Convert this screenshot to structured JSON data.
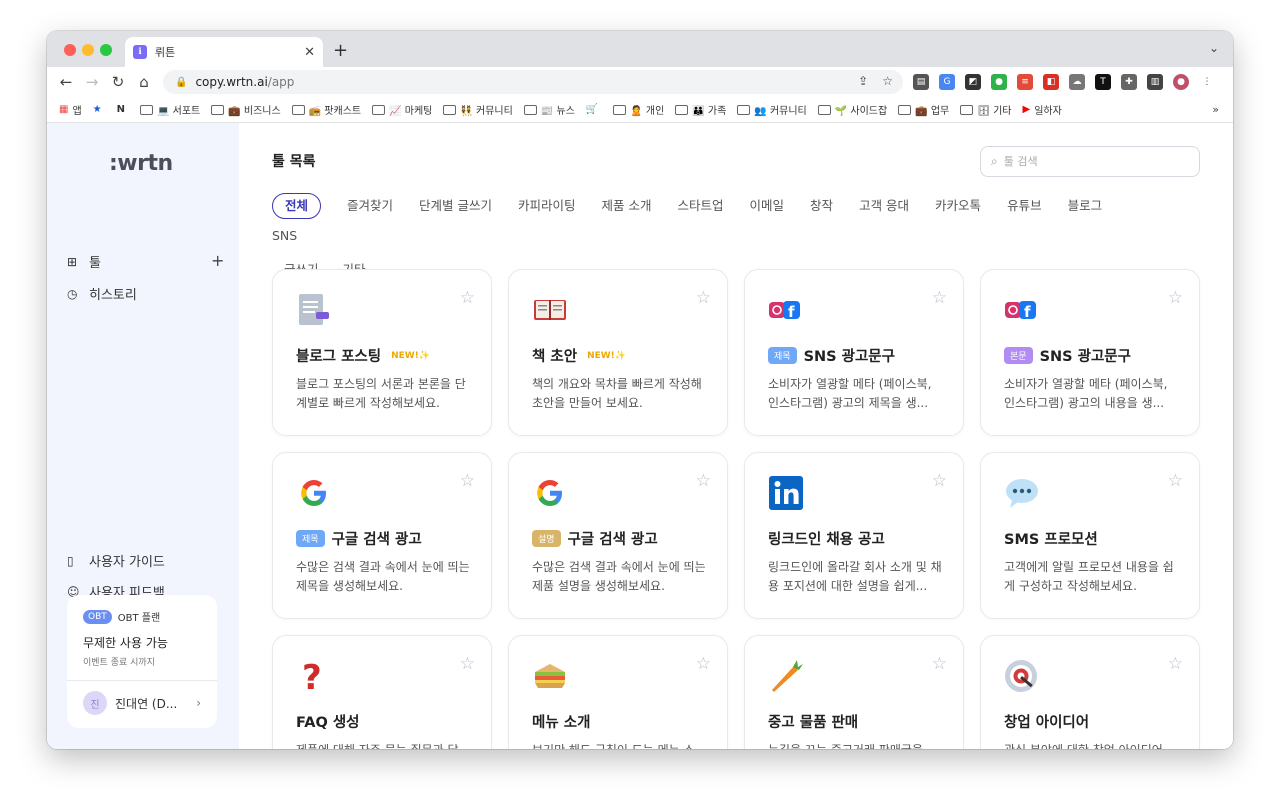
{
  "browser": {
    "tab_title": "뤼튼",
    "tab_favicon": "ℹ",
    "url_host": "copy.wrtn.ai",
    "url_path": "/app",
    "bookmarks": [
      {
        "icon": "apps-icon",
        "label": "앱"
      },
      {
        "icon": "star-icon",
        "label": ""
      },
      {
        "icon": "notion-icon",
        "label": ""
      },
      {
        "icon": "folder-icon",
        "label": "💻 서포트"
      },
      {
        "icon": "folder-icon",
        "label": "💼 비즈니스"
      },
      {
        "icon": "folder-icon",
        "label": "📻 팟캐스트"
      },
      {
        "icon": "folder-icon",
        "label": "📈 마케팅"
      },
      {
        "icon": "folder-icon",
        "label": "👯 커뮤니티"
      },
      {
        "icon": "folder-icon",
        "label": "📰 뉴스"
      },
      {
        "icon": "cart-icon",
        "label": ""
      },
      {
        "icon": "folder-icon",
        "label": "🙎 개인"
      },
      {
        "icon": "folder-icon",
        "label": "👪 가족"
      },
      {
        "icon": "folder-icon",
        "label": "👥 커뮤니티"
      },
      {
        "icon": "folder-icon",
        "label": "🌱 사이드잡"
      },
      {
        "icon": "folder-icon",
        "label": "💼 업무"
      },
      {
        "icon": "folder-icon",
        "label": "🗄 기타"
      },
      {
        "icon": "youtube-icon",
        "label": "일하자"
      }
    ]
  },
  "sidebar": {
    "logo": ":wrtn",
    "tools_label": "툴",
    "history_label": "히스토리",
    "guide_label": "사용자 가이드",
    "feedback_label": "사용자 피드백",
    "obt": {
      "badge": "OBT",
      "plan": "OBT 플랜",
      "title": "무제한 사용 가능",
      "subtitle": "이벤트 종료 시까지"
    },
    "user": {
      "avatar": "진",
      "name": "진대연 (D..."
    }
  },
  "main": {
    "title": "툴 목록",
    "search_placeholder": "툴 검색",
    "categories_row1": [
      "전체",
      "즐겨찾기",
      "단계별 글쓰기",
      "카피라이팅",
      "제품 소개",
      "스타트업",
      "이메일",
      "창작",
      "고객 응대",
      "카카오톡",
      "유튜브",
      "블로그",
      "SNS"
    ],
    "categories_row2": [
      "글쓰기",
      "기타"
    ],
    "cards": [
      {
        "icon": "document-icon",
        "title": "블로그 포스팅",
        "tag": "",
        "new": "NEW!✨",
        "desc": "블로그 포스팅의 서론과 본론을 단계별로 빠르게 작성해보세요."
      },
      {
        "icon": "book-icon",
        "title": "책 초안",
        "tag": "",
        "new": "NEW!✨",
        "desc": "책의 개요와 목차를 빠르게 작성해 초안을 만들어 보세요."
      },
      {
        "icon": "instagram-facebook-icon",
        "title": "SNS 광고문구",
        "tag": "제목",
        "new": "",
        "desc": "소비자가 열광할 메타 (페이스북, 인스타그램) 광고의 제목을 생..."
      },
      {
        "icon": "instagram-facebook-icon",
        "title": "SNS 광고문구",
        "tag": "본문",
        "new": "",
        "desc": "소비자가 열광할 메타 (페이스북, 인스타그램) 광고의 내용을 생..."
      },
      {
        "icon": "google-icon",
        "title": "구글 검색 광고",
        "tag": "제목",
        "new": "",
        "desc": "수많은 검색 결과 속에서 눈에 띄는 제목을 생성해보세요."
      },
      {
        "icon": "google-icon",
        "title": "구글 검색 광고",
        "tag": "설명",
        "new": "",
        "desc": "수많은 검색 결과 속에서 눈에 띄는 제품 설명을 생성해보세요."
      },
      {
        "icon": "linkedin-icon",
        "title": "링크드인 채용 공고",
        "tag": "",
        "new": "",
        "desc": "링크드인에 올라갈 회사 소개 및 채용 포지션에 대한 설명을 쉽게..."
      },
      {
        "icon": "speech-bubble-icon",
        "title": "SMS 프로모션",
        "tag": "",
        "new": "",
        "desc": "고객에게 알릴 프로모션 내용을 쉽게 구성하고 작성해보세요."
      },
      {
        "icon": "question-mark-icon",
        "title": "FAQ 생성",
        "tag": "",
        "new": "",
        "desc": "제품에 대해 자주 묻는 질문과 답..."
      },
      {
        "icon": "sandwich-icon",
        "title": "메뉴 소개",
        "tag": "",
        "new": "",
        "desc": "보기만 해도 군침이 도는 메뉴 소..."
      },
      {
        "icon": "carrot-icon",
        "title": "중고 물품 판매",
        "tag": "",
        "new": "",
        "desc": "눈길을 끄는 중고거래 판매글을..."
      },
      {
        "icon": "dart-target-icon",
        "title": "창업 아이디어",
        "tag": "",
        "new": "",
        "desc": "관심 분야에 대한 창업 아이디어..."
      }
    ],
    "tag_colors": {
      "제목": "#6ea8f7",
      "본문": "#b18cf2",
      "설명": "#d8b46a"
    }
  }
}
